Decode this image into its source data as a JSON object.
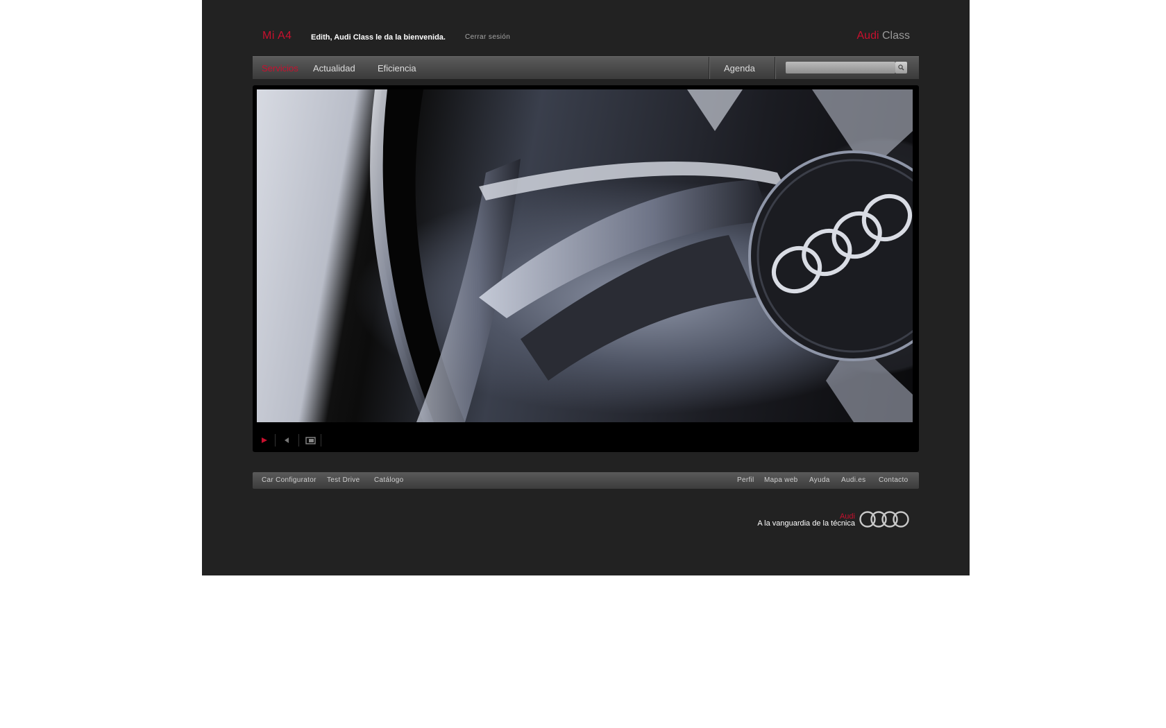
{
  "header": {
    "model": "Mi A4",
    "welcome": "Edith, Audi Class le da la bienvenida.",
    "logout": "Cerrar sesión",
    "brand_audi": "Audi",
    "brand_class": "Class"
  },
  "nav": {
    "items": [
      {
        "label": "Servicios",
        "active": true
      },
      {
        "label": "Actualidad",
        "active": false
      },
      {
        "label": "Eficiencia",
        "active": false
      }
    ],
    "agenda": "Agenda",
    "search": {
      "value": "",
      "icon": "search-icon"
    }
  },
  "player": {
    "video_content": "Audi wheel rim close-up",
    "controls": [
      "play-icon",
      "volume-icon",
      "fullscreen-icon"
    ]
  },
  "footer": {
    "left_links": [
      "Car Configurator",
      "Test Drive",
      "Catálogo"
    ],
    "right_links": [
      "Perfil",
      "Mapa web",
      "Ayuda",
      "Audi.es",
      "Contacto"
    ],
    "tagline_brand": "Audi",
    "tagline": "A la vanguardia de la técnica"
  },
  "colors": {
    "accent": "#c8102e",
    "background": "#222222",
    "page": "#ffffff"
  }
}
